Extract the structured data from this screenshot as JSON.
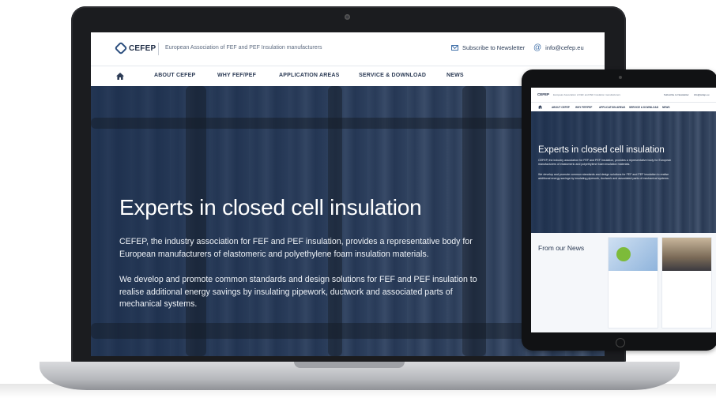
{
  "site": {
    "logo": "CEFEP",
    "tagline": "European Association of FEF and PEF Insulation manufacturers",
    "newsletter_label": "Subscribe to Newsletter",
    "email_label": "info@cefep.eu"
  },
  "nav": {
    "items": [
      "ABOUT CEFEP",
      "WHY FEF/PEF",
      "APPLICATION AREAS",
      "SERVICE & DOWNLOAD",
      "NEWS"
    ]
  },
  "hero": {
    "title": "Experts in closed cell insulation",
    "paragraph1": "CEFEP, the industry association for FEF and PEF insulation, provides a representative body for European manufacturers of elastomeric and polyethylene foam insulation materials.",
    "paragraph2": "We develop and promote common standards and design solutions for FEF and PEF insulation to realise additional energy savings by insulating pipework, ductwork and associated parts of mechanical systems."
  },
  "tablet": {
    "hero_title": "Experts in closed cell insulation",
    "news_title": "From our News"
  }
}
